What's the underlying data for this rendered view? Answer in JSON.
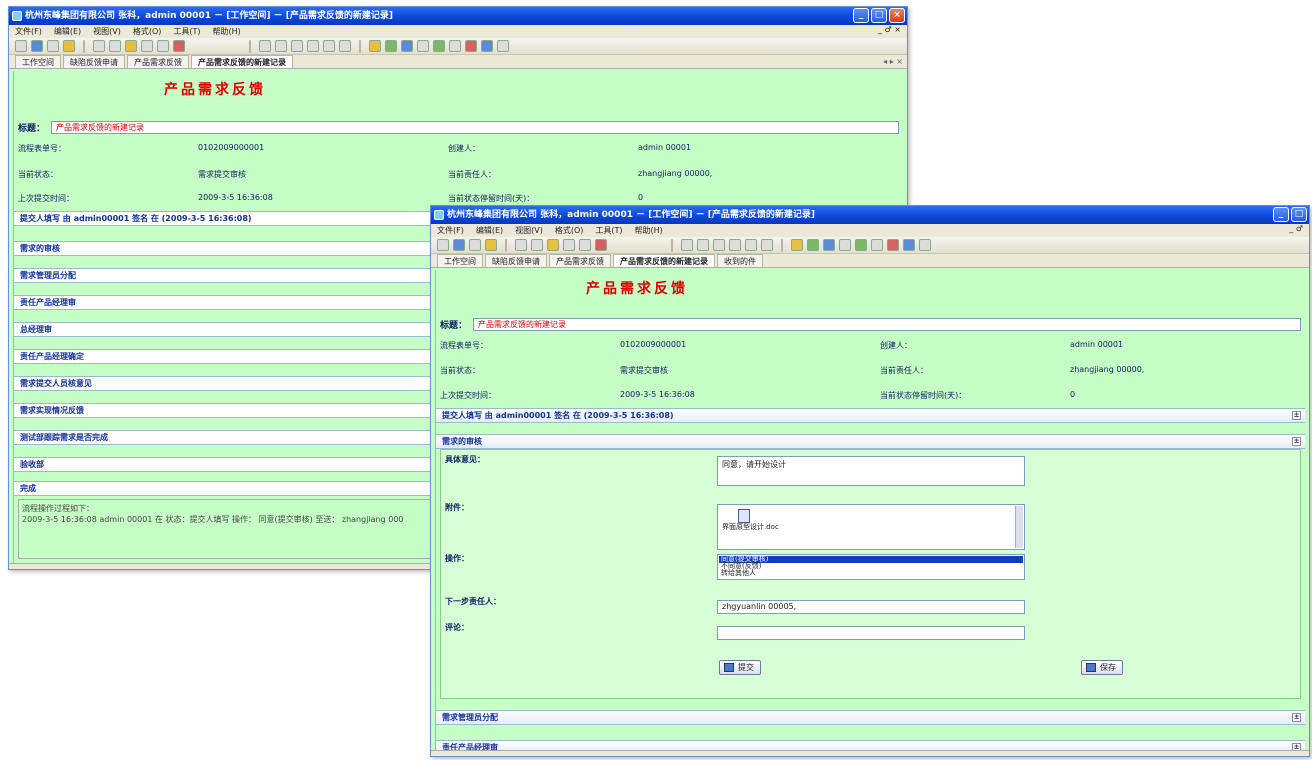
{
  "window1": {
    "title": "杭州东峰集团有限公司 张科，admin 00001 － [工作空间] － [产品需求反馈的新建记录]",
    "menu": [
      "文件(F)",
      "编辑(E)",
      "视图(V)",
      "格式(O)",
      "工具(T)",
      "帮助(H)"
    ],
    "mdi_controls": "_ ♂ ×",
    "tabs": [
      "工作空间",
      "缺陷反馈申请",
      "产品需求反馈",
      "产品需求反馈的新建记录"
    ],
    "heading": "产品需求反馈",
    "title_label": "标题：",
    "title_value": "产品需求反馈的新建记录",
    "info": {
      "flow_no_label": "流程表单号：",
      "flow_no": "0102009000001",
      "creator_label": "创建人：",
      "creator": "admin 00001",
      "state_label": "当前状态：",
      "state": "需求提交审核",
      "owner_label": "当前责任人：",
      "owner": "zhangjiang 00000,",
      "submit_label": "上次提交时间：",
      "submit_time": "2009-3-5 16:36:08",
      "stay_label": "当前状态停留时间(天)：",
      "stay": "0"
    },
    "sections": [
      "提交人填写   由 admin00001 签名 在 (2009-3-5 16:36:08)",
      "需求的审核",
      "需求管理员分配",
      "责任产品经理审",
      "总经理审",
      "责任产品经理确定",
      "需求提交人员核意见",
      "需求实现情况反馈",
      "测试部跟踪需求是否完成",
      "验收部",
      "完成"
    ],
    "log_title": "流程操作过程如下：",
    "log_entry": "2009-3-5 16:36:08 admin 00001 在 状态：提交人填写 操作： 同意(提交审核) 至送： zhangjiang 000"
  },
  "window2": {
    "title": "杭州东峰集团有限公司 张科，admin 00001 － [工作空间] － [产品需求反馈的新建记录]",
    "menu": [
      "文件(F)",
      "编辑(E)",
      "视图(V)",
      "格式(O)",
      "工具(T)",
      "帮助(H)"
    ],
    "mdi_controls": "_ ♂",
    "tabs": [
      "工作空间",
      "缺陷反馈申请",
      "产品需求反馈",
      "产品需求反馈的新建记录",
      "收到的件"
    ],
    "heading": "产品需求反馈",
    "title_label": "标题：",
    "title_value": "产品需求反馈的新建记录",
    "info": {
      "flow_no_label": "流程表单号：",
      "flow_no": "0102009000001",
      "creator_label": "创建人：",
      "creator": "admin 00001",
      "state_label": "当前状态：",
      "state": "需求提交审核",
      "owner_label": "当前责任人：",
      "owner": "zhangjiang 00000,",
      "submit_label": "上次提交时间：",
      "submit_time": "2009-3-5 16:36:08",
      "stay_label": "当前状态停留时间(天)：",
      "stay": "0"
    },
    "section_submitter": "提交人填写   由 admin00001 签名 在 (2009-3-5 16:36:08)",
    "section_review": "需求的审核",
    "form": {
      "opinion_label": "具体意见：",
      "opinion_value": "同意，请开始设计",
      "attachment_label": "附件：",
      "attachment_name": "界面原型设计.doc",
      "operation_label": "操作：",
      "operations": [
        "同意(提交审核)",
        "不同意(反馈)",
        "转给其他人"
      ],
      "next_label": "下一步责任人：",
      "next_value": "zhgyuanlin 00005,",
      "comment_label": "评论：",
      "comment_value": "",
      "submit_btn": "提交",
      "save_btn": "保存"
    },
    "sections_below": [
      "需求管理员分配",
      "责任产品经理审"
    ]
  }
}
